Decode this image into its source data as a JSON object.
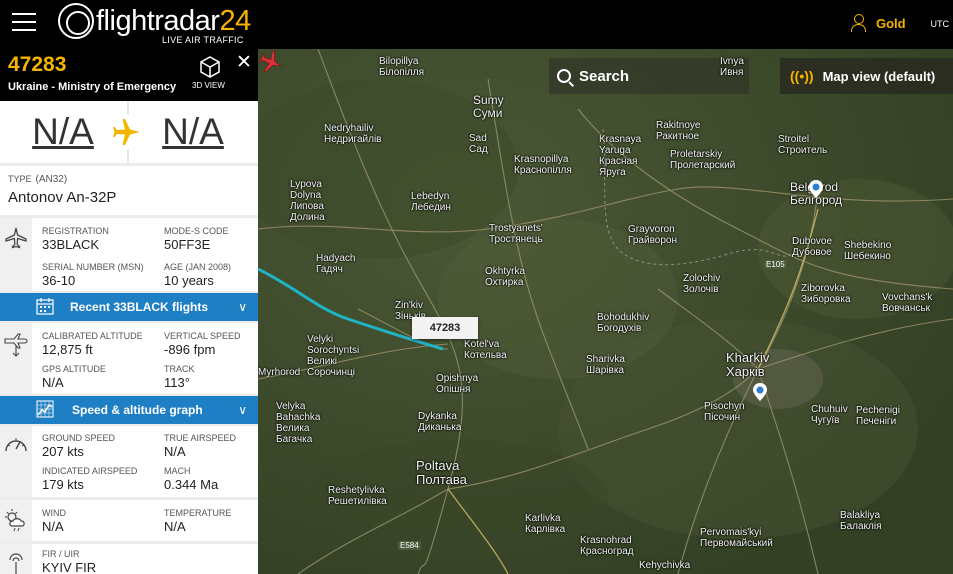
{
  "header": {
    "logo_text": "flightradar",
    "logo_num": "24",
    "logo_tagline": "LIVE AIR TRAFFIC",
    "account_label": "Gold",
    "time_label": "UTC"
  },
  "flight": {
    "callsign": "47283",
    "operator": "Ukraine - Ministry of Emergency",
    "view3d_label": "3D VIEW",
    "origin": "N/A",
    "destination": "N/A"
  },
  "aircraft": {
    "type_label": "TYPE",
    "type_code": "(AN32)",
    "type_name": "Antonov An-32P",
    "registration_label": "REGISTRATION",
    "registration": "33BLACK",
    "modes_label": "MODE-S CODE",
    "modes": "50FF3E",
    "msn_label": "SERIAL NUMBER (MSN)",
    "msn": "36-10",
    "age_label": "AGE",
    "age_note": "(JAN 2008)",
    "age": "10 years"
  },
  "recent_flights_label": "Recent 33BLACK flights",
  "altitude": {
    "cal_alt_label": "CALIBRATED ALTITUDE",
    "cal_alt": "12,875 ft",
    "vspeed_label": "VERTICAL SPEED",
    "vspeed": "-896 fpm",
    "gps_alt_label": "GPS ALTITUDE",
    "gps_alt": "N/A",
    "track_label": "TRACK",
    "track": "113°"
  },
  "graph_label": "Speed & altitude graph",
  "speed": {
    "gs_label": "GROUND SPEED",
    "gs": "207 kts",
    "tas_label": "TRUE AIRSPEED",
    "tas": "N/A",
    "ias_label": "INDICATED AIRSPEED",
    "ias": "179 kts",
    "mach_label": "MACH",
    "mach": "0.344 Ma"
  },
  "weather": {
    "wind_label": "WIND",
    "wind": "N/A",
    "temp_label": "TEMPERATURE",
    "temp": "N/A"
  },
  "fir": {
    "label": "FIR / UIR",
    "value": "KYIV FIR"
  },
  "map": {
    "search_label": "Search",
    "view_icon": "((•))",
    "view_label": "Map view (default)",
    "flight_tag": "47283",
    "cities": [
      {
        "name": "Bilopillya\nБілопілля"
      },
      {
        "name": "Sumy\nСуми"
      },
      {
        "name": "Nedryhailiv\nНедригайлів"
      },
      {
        "name": "Sad\nСад"
      },
      {
        "name": "Krasnaya\nYaruga\nКрасная\nЯруга"
      },
      {
        "name": "Rakitnoye\nРакитное"
      },
      {
        "name": "Proletarskiy\nПролетарский"
      },
      {
        "name": "Stroitel\nСтроитель"
      },
      {
        "name": "Belgorod\nБелгород"
      },
      {
        "name": "Krasnopillya\nКраснопілля"
      },
      {
        "name": "Lypova\nDolyna\nЛипова\nДолина"
      },
      {
        "name": "Lebedyn\nЛебедин"
      },
      {
        "name": "Trostyanets'\nТростянець"
      },
      {
        "name": "Grayvoron\nГрайворон"
      },
      {
        "name": "Dubovoe\nДубовое"
      },
      {
        "name": "Shebekino\nШебекино"
      },
      {
        "name": "Hadyach\nГадяч"
      },
      {
        "name": "Okhtyrka\nОхтирка"
      },
      {
        "name": "Zolochiv\nЗолочів"
      },
      {
        "name": "Ziborovka\nЗиборовка"
      },
      {
        "name": "Vovchans'k\nВовчанськ"
      },
      {
        "name": "Zin'kiv\nЗіньків"
      },
      {
        "name": "Bohodukhiv\nБогодухів"
      },
      {
        "name": "Velyki\nSorochyntsi\nВеликі\nСорочинці"
      },
      {
        "name": "Kotel'va\nКотельва"
      },
      {
        "name": "Sharivka\nШарівка"
      },
      {
        "name": "Kharkiv\nХарків"
      },
      {
        "name": "Myrhorod"
      },
      {
        "name": "Opishnya\nОпішня"
      },
      {
        "name": "Pisochyn\nПісочин"
      },
      {
        "name": "Chuhuiv\nЧугуїв"
      },
      {
        "name": "Pechenigi\nПеченіги"
      },
      {
        "name": "Velyka\nBahachka\nВелика\nБагачка"
      },
      {
        "name": "Dykanka\nДиканька"
      },
      {
        "name": "Poltava\nПолтава"
      },
      {
        "name": "Reshetylivka\nРешетилівка"
      },
      {
        "name": "Karlivka\nКарлівка"
      },
      {
        "name": "Krasnohrad\nКрасноград"
      },
      {
        "name": "Pervomais'kyi\nПервомайський"
      },
      {
        "name": "Balakliya\nБалаклія"
      },
      {
        "name": "Kehychivka"
      },
      {
        "name": "Ivnya\nИвня"
      }
    ],
    "roads": [
      "E105",
      "E584"
    ]
  },
  "colors": {
    "accent": "#f5b400",
    "blue_bar": "#1f7fc4",
    "track_line": "#1fb3c4",
    "plane_marker": "#e0303a"
  }
}
